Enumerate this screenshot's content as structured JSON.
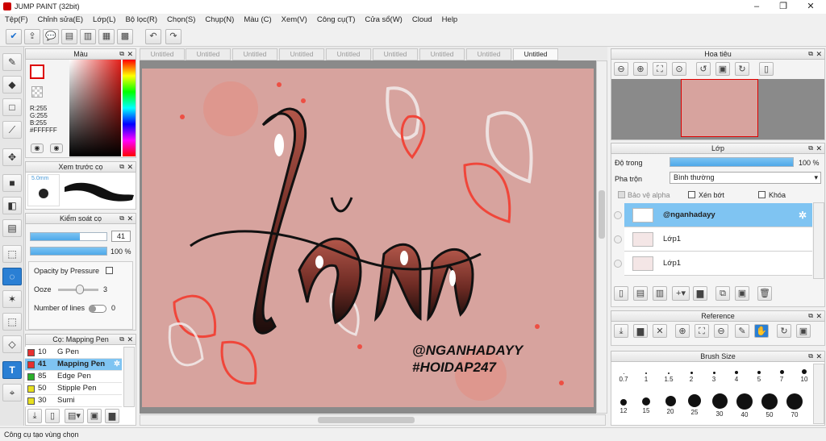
{
  "app": {
    "title": "JUMP PAINT (32bit)"
  },
  "menu": [
    "Tệp(F)",
    "Chỉnh sửa(E)",
    "Lớp(L)",
    "Bộ lọc(R)",
    "Chọn(S)",
    "Chụp(N)",
    "Màu (C)",
    "Xem(V)",
    "Công cụ(T)",
    "Cửa sổ(W)",
    "Cloud",
    "Help"
  ],
  "tabs": [
    "Untitled",
    "Untitled",
    "Untitled",
    "Untitled",
    "Untitled",
    "Untitled",
    "Untitled",
    "Untitled",
    "Untitled"
  ],
  "color_panel": {
    "title": "Màu",
    "r": "R:255",
    "g": "G:255",
    "b": "B:255",
    "hex": "#FFFFFF"
  },
  "brush_preview": {
    "title": "Xem trước cọ",
    "size": "5.0mm"
  },
  "brush_control": {
    "title": "Kiểm soát cọ",
    "size_value": "41",
    "opacity_value": "100 %",
    "opacity_pressure": "Opacity by Pressure",
    "ooze": "Ooze",
    "ooze_value": "3",
    "lines": "Number of lines",
    "lines_value": "0"
  },
  "brush_list": {
    "title": "Cọ: Mapping Pen",
    "items": [
      {
        "num": "10",
        "name": "G Pen",
        "color": "#e83030"
      },
      {
        "num": "41",
        "name": "Mapping Pen",
        "color": "#e83030"
      },
      {
        "num": "85",
        "name": "Edge Pen",
        "color": "#2bb02b"
      },
      {
        "num": "50",
        "name": "Stipple Pen",
        "color": "#e8e020"
      },
      {
        "num": "30",
        "name": "Sumi",
        "color": "#e8e020"
      }
    ]
  },
  "navigator": {
    "title": "Hoa tiêu"
  },
  "layers": {
    "title": "Lớp",
    "opacity_label": "Độ trong",
    "opacity_value": "100 %",
    "blend_label": "Pha trộn",
    "blend_value": "Bình thường",
    "protect_alpha": "Bảo vệ alpha",
    "clip": "Xén bớt",
    "lock": "Khóa",
    "items": [
      {
        "name": "@nganhadayy"
      },
      {
        "name": "Lớp1"
      },
      {
        "name": "Lớp1"
      }
    ]
  },
  "reference": {
    "title": "Reference"
  },
  "brush_size": {
    "title": "Brush Size",
    "row1": [
      "0.7",
      "1",
      "1.5",
      "2",
      "3",
      "4",
      "5",
      "7",
      "10"
    ],
    "row2": [
      "12",
      "15",
      "20",
      "25",
      "30",
      "40",
      "50",
      "70"
    ]
  },
  "artwork": {
    "main_text": "lằn",
    "handle": "@NGANHADAYY",
    "tag": "#HOIDAP247"
  },
  "status": "Công cụ tạo vùng chọn"
}
